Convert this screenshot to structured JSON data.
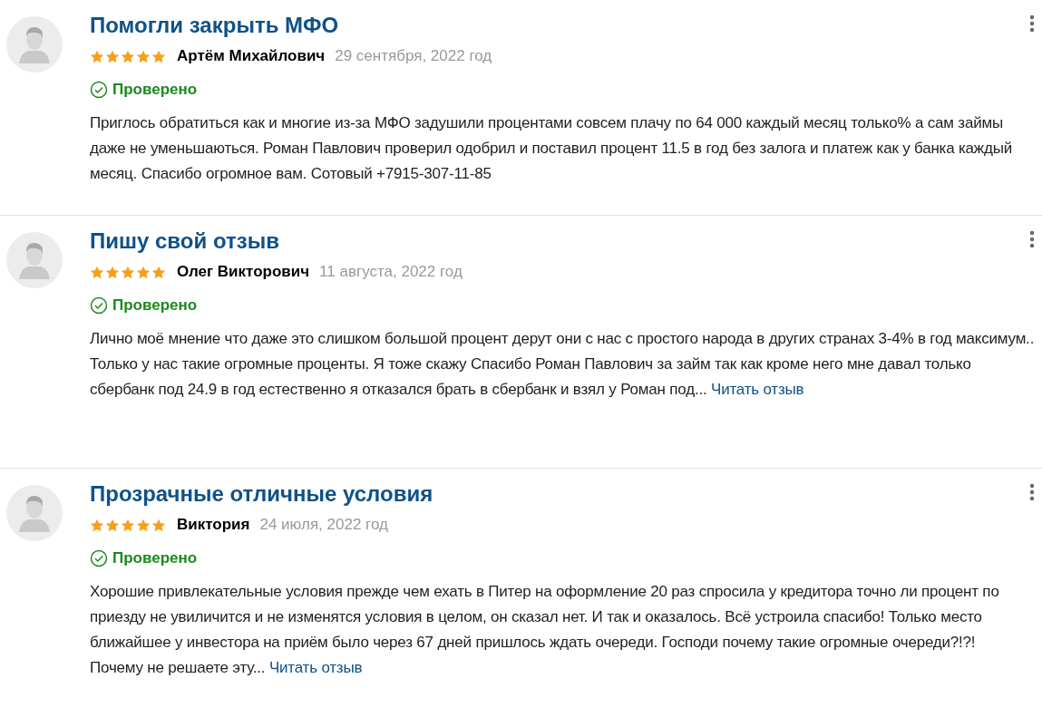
{
  "reviews": [
    {
      "title": "Помогли закрыть МФО",
      "stars": 5,
      "author": "Артём Михайлович",
      "date": "29 сентября, 2022 год",
      "verified": true,
      "verified_label": "Проверено",
      "text": "Приглось обратиться как и многие из-за МФО задушили процентами совсем плачу по 64 000 каждый месяц только% а сам займы даже не уменьшаються. Роман Павлович проверил одобрил и поставил процент 11.5 в год без залога и платеж как у банка каждый месяц. Спасибо огромное вам. Сотовый +7915-307-11-85"
    },
    {
      "title": "Пишу свой отзыв",
      "stars": 5,
      "author": "Олег Викторович",
      "date": "11 августа, 2022 год",
      "verified": true,
      "verified_label": "Проверено",
      "text": "Лично моё мнение что даже это слишком большой процент дерут они с нас с простого народа в других странах 3-4% в год максимум.. Только у нас такие огромные проценты. Я тоже скажу Спасибо Роман Павлович за займ так как кроме него мне давал только сбербанк под 24.9 в год естественно я отказался брать в сбербанк и взял у Роман под...",
      "read_more": "Читать отзыв"
    },
    {
      "title": "Прозрачные отличные условия",
      "stars": 5,
      "author": "Виктория",
      "date": "24 июля, 2022 год",
      "verified": true,
      "verified_label": "Проверено",
      "text": "Хорошие привлекательные условия прежде чем ехать в Питер на оформление 20 раз спросила у кредитора точно ли процент по приезду не увиличится и не изменятся условия в целом, он сказал нет. И так и оказалось. Всё устроила спасибо! Только место ближайшее у инвестора на приём было через 67 дней пришлось ждать очереди. Господи почему такие огромные очереди?!?!\nПочему не решаете эту...",
      "read_more": "Читать отзыв"
    }
  ]
}
